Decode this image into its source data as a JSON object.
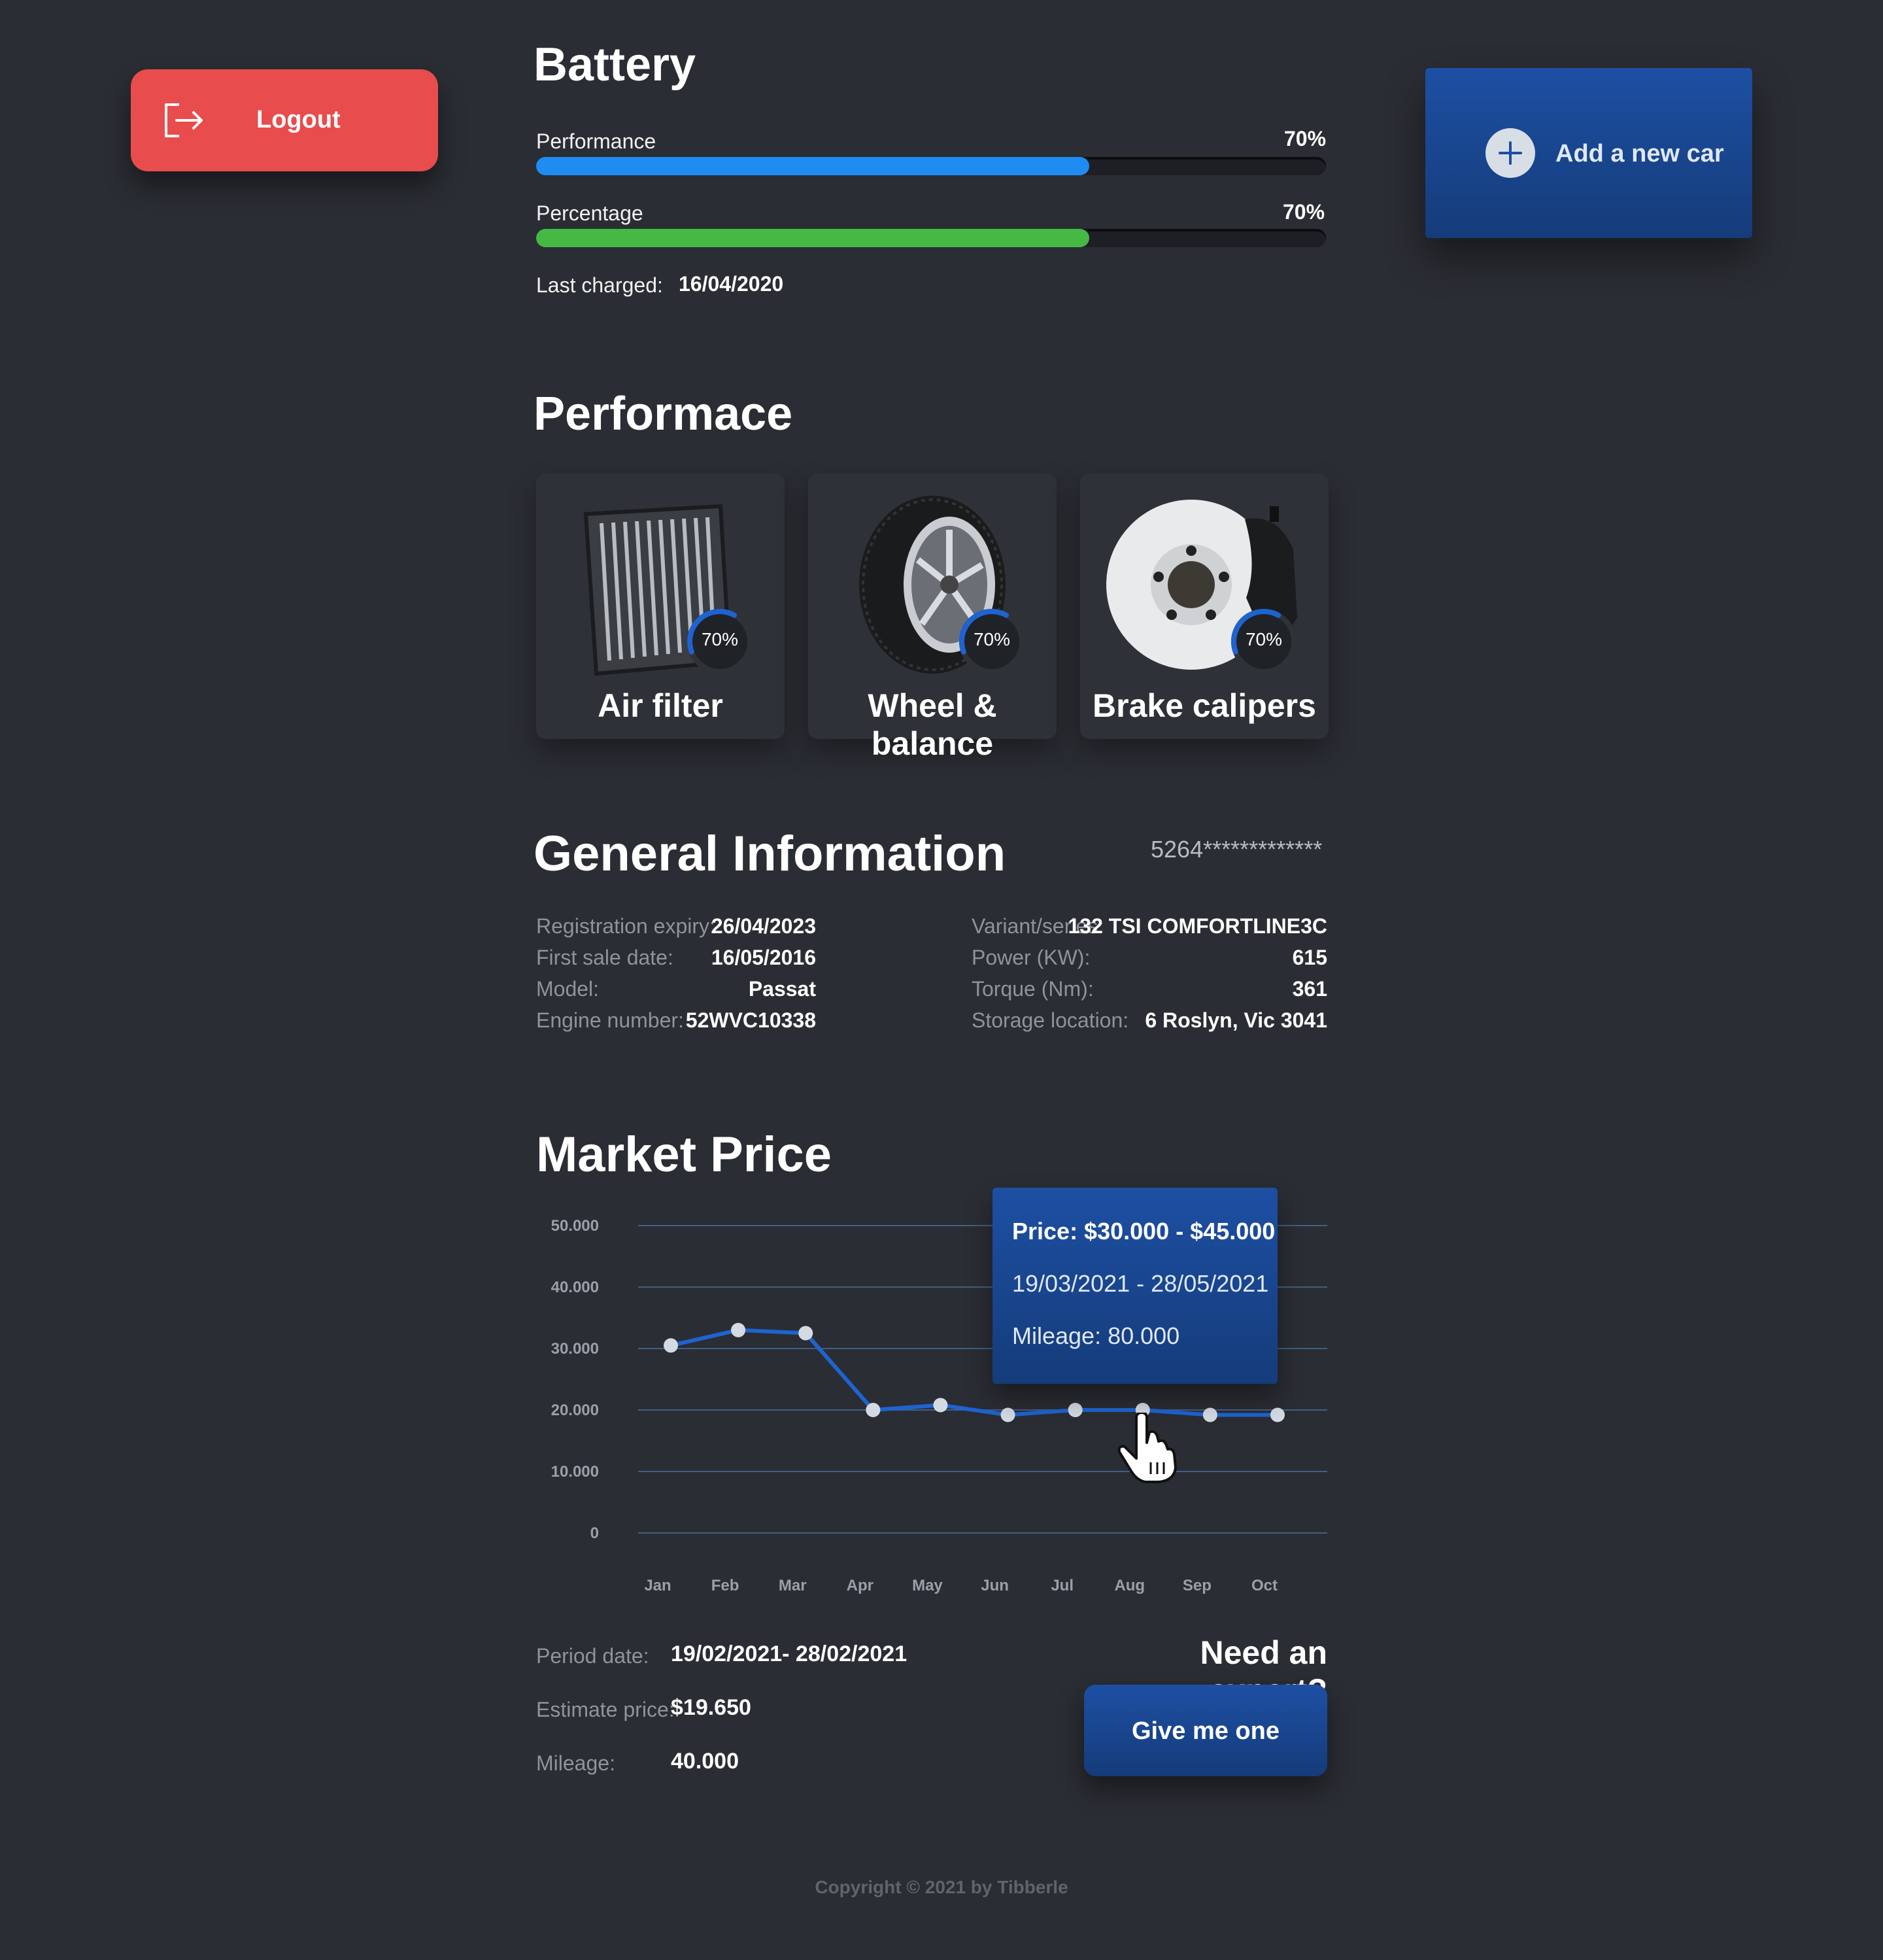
{
  "logout": {
    "label": "Logout"
  },
  "add_car": {
    "label": "Add a new car"
  },
  "battery": {
    "title": "Battery",
    "bars": [
      {
        "label": "Performance",
        "value": "70%",
        "fraction": 0.7,
        "color": "#1e8cf0"
      },
      {
        "label": "Percentage",
        "value": "70%",
        "fraction": 0.7,
        "color": "#45b944"
      }
    ],
    "last_charged_label": "Last charged:",
    "last_charged_value": "16/04/2020"
  },
  "performance": {
    "title": "Performace",
    "cards": [
      {
        "title": "Air filter",
        "percent": "70%",
        "fraction": 0.7
      },
      {
        "title": "Wheel & balance",
        "percent": "70%",
        "fraction": 0.7
      },
      {
        "title": "Brake calipers",
        "percent": "70%",
        "fraction": 0.7
      }
    ]
  },
  "general": {
    "title": "General Information",
    "card_number": "5264*************",
    "left": [
      {
        "label": "Registration expiry:",
        "value": "26/04/2023"
      },
      {
        "label": "First sale date:",
        "value": "16/05/2016"
      },
      {
        "label": "Model:",
        "value": "Passat"
      },
      {
        "label": "Engine number:",
        "value": "52WVC10338"
      }
    ],
    "right": [
      {
        "label": "Variant/series:",
        "value": "132 TSI COMFORTLINE3C"
      },
      {
        "label": "Power (KW):",
        "value": "615"
      },
      {
        "label": "Torque (Nm):",
        "value": "361"
      },
      {
        "label": "Storage location:",
        "value": "6 Roslyn, Vic 3041"
      }
    ]
  },
  "market": {
    "title": "Market Price",
    "tooltip": {
      "price": "Price: $30.000 - $45.000",
      "dates": "19/03/2021 - 28/05/2021",
      "mileage": "Mileage: 80.000"
    },
    "period_label": "Period date:",
    "period_value": "19/02/2021- 28/02/2021",
    "estimate_label": "Estimate price:",
    "estimate_value": "$19.650",
    "mileage_label": "Mileage:",
    "mileage_value": "40.000",
    "expert_title": "Need an expert?",
    "expert_button": "Give me one"
  },
  "chart_data": {
    "type": "line",
    "categories": [
      "Jan",
      "Feb",
      "Mar",
      "Apr",
      "May",
      "Jun",
      "Jul",
      "Aug",
      "Sep",
      "Oct"
    ],
    "y_ticks": [
      "50.000",
      "40.000",
      "30.000",
      "20.000",
      "10.000",
      "0"
    ],
    "ylim": [
      0,
      50000
    ],
    "series": [
      {
        "values": [
          30500,
          33000,
          32500,
          20000,
          20800,
          19200,
          20000,
          20000,
          19200,
          19200
        ],
        "color": "#1e63d0"
      }
    ],
    "grid": true
  },
  "footer": {
    "text": "Copyright © 2021 by Tibberle"
  }
}
